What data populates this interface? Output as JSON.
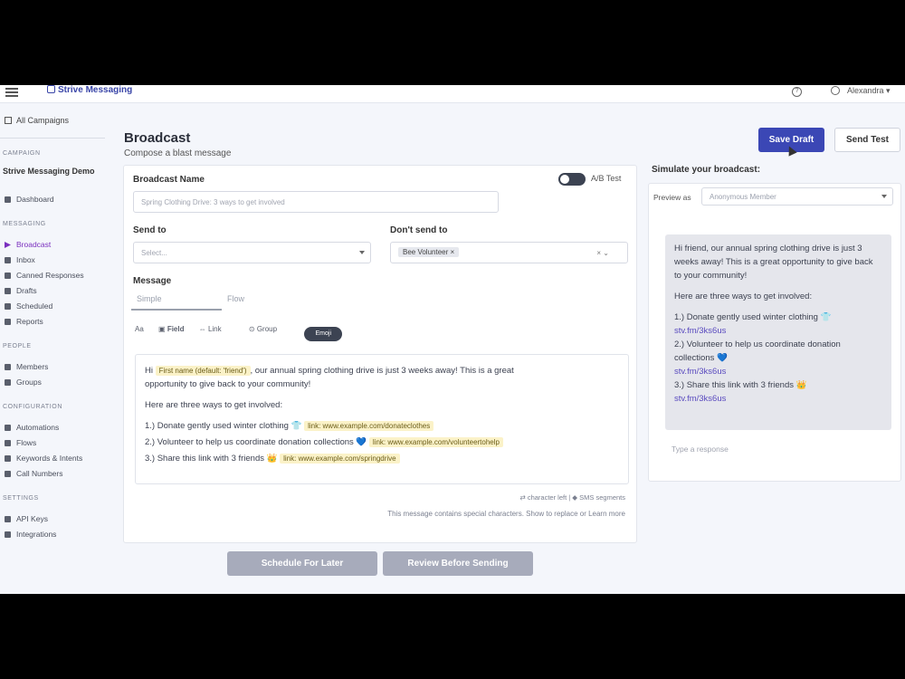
{
  "topbar": {
    "brand": "Strive Messaging",
    "user": "Alexandra ▾"
  },
  "sidebar": {
    "all_campaigns": "All Campaigns",
    "campaign_section": "Campaign",
    "campaign_name": "Strive Messaging Demo",
    "dashboard": "Dashboard",
    "messaging_section": "Messaging",
    "messaging_items": [
      "Broadcast",
      "Inbox",
      "Canned Responses",
      "Drafts",
      "Scheduled",
      "Reports"
    ],
    "people_section": "People",
    "people_items": [
      "Members",
      "Groups"
    ],
    "config_section": "Configuration",
    "config_items": [
      "Automations",
      "Flows",
      "Keywords & Intents",
      "Call Numbers"
    ],
    "settings_section": "Settings",
    "settings_items": [
      "API Keys",
      "Integrations"
    ]
  },
  "header": {
    "title": "Broadcast",
    "subtitle": "Compose a blast message",
    "save_draft": "Save Draft",
    "send_test": "Send Test"
  },
  "form": {
    "broadcast_name_label": "Broadcast Name",
    "broadcast_name_value": "Spring Clothing Drive: 3 ways to get involved",
    "ab_test_label": "A/B Test",
    "send_to_label": "Send to",
    "send_to_placeholder": "Select...",
    "dont_send_label": "Don't send to",
    "dont_send_chip": "Bee Volunteer ×",
    "clear": "× ⌄",
    "message_label": "Message",
    "tab_simple": "Simple",
    "tab_flow": "Flow",
    "toolbar": {
      "text": "Aa",
      "field": "Field",
      "link": "Link",
      "group": "Group",
      "emoji": "Emoji"
    },
    "message": {
      "line1_a": "Hi ",
      "line1_tag": "First name (default: 'friend')",
      "line1_b": ", our annual spring clothing drive is just 3 weeks away! This is a great",
      "line1_c": "opportunity to give back to your community!",
      "line2": "Here are three ways to get involved:",
      "item1": "1.) Donate gently used winter clothing 👕 ",
      "item1_tag": "link: www.example.com/donateclothes",
      "item2": "2.) Volunteer to help us coordinate donation collections 💙 ",
      "item2_tag": "link: www.example.com/volunteertohelp",
      "item3": "3.) Share this link with 3 friends 👑 ",
      "item3_tag": "link: www.example.com/springdrive"
    },
    "footer_counts": "⇄ character left  |  ◆ SMS segments",
    "note": "This message contains special characters. Show to replace or Learn more",
    "schedule_btn": "Schedule For Later",
    "review_btn": "Review Before Sending"
  },
  "simulate": {
    "title": "Simulate your broadcast:",
    "preview_label": "Preview as",
    "preview_value": "Anonymous Member",
    "p1": "Hi friend, our annual spring clothing drive is just 3 weeks away! This is a great opportunity to give back to your community!",
    "p2": "Here are three ways to get involved:",
    "i1": "1.) Donate gently used winter clothing 👕",
    "l1": "stv.fm/3ks6us",
    "i2": "2.) Volunteer to help us coordinate donation collections 💙",
    "l2": "stv.fm/3ks6us",
    "i3": "3.) Share this link with 3 friends 👑",
    "l3": "stv.fm/3ks6us",
    "compose_placeholder": "Type a response"
  }
}
